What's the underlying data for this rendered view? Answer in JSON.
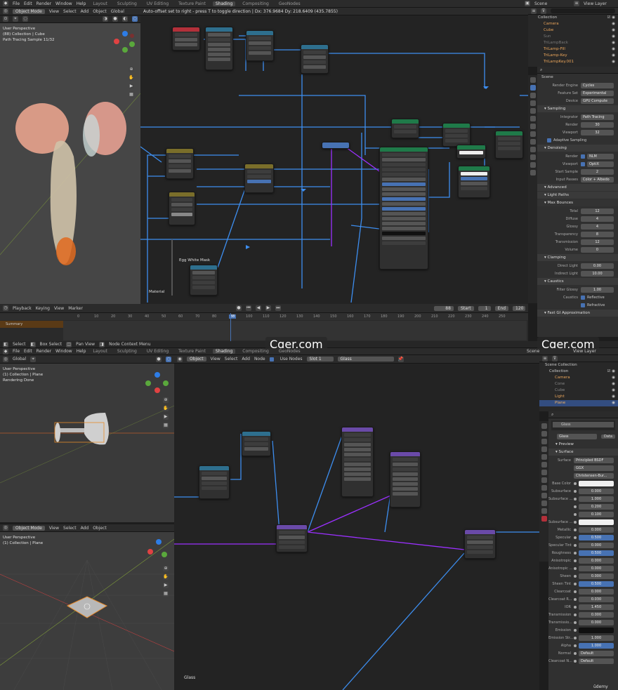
{
  "top": {
    "menu": [
      "File",
      "Edit",
      "Render",
      "Window",
      "Help"
    ],
    "workspaces": [
      "Layout",
      "Sculpting",
      "UV Editing",
      "Texture Paint",
      "Shading",
      "Compositing",
      "GeoNodes"
    ],
    "active_workspace": "Shading",
    "scene": "Scene",
    "view_layer": "View Layer",
    "viewport_header": [
      "Object Mode",
      "View",
      "Select",
      "Add",
      "Object"
    ],
    "transform": "Global",
    "node_status": "Auto-offset set to right - press T to toggle direction  |  Dx: 376.9684   Dy: 218.6409 (435.7855)",
    "viewport_info": [
      "User Perspective",
      "(88) Collection | Cube",
      "Path Tracing Sample 11/32"
    ],
    "node_frame_label": "Egg White Mask",
    "material_label": "Material",
    "outliner_title": "Collection",
    "outliner": [
      {
        "name": "Camera"
      },
      {
        "name": "Cube"
      },
      {
        "name": "Sun"
      },
      {
        "name": "TriLampBack"
      },
      {
        "name": "TriLamp-Fill"
      },
      {
        "name": "TriLamp-Key"
      },
      {
        "name": "TriLampKey.001"
      }
    ],
    "timeline": {
      "menu": [
        "Playback",
        "Keying",
        "View",
        "Marker"
      ],
      "current": "88",
      "start_label": "Start",
      "start": "1",
      "end_label": "End",
      "end": "120",
      "summary": "Summary",
      "ticks": [
        "0",
        "10",
        "20",
        "30",
        "40",
        "50",
        "60",
        "70",
        "80",
        "88",
        "100",
        "110",
        "120",
        "130",
        "140",
        "150",
        "160",
        "170",
        "180",
        "190",
        "200",
        "210",
        "220",
        "230",
        "240",
        "250"
      ]
    },
    "status": [
      "Select",
      "Box Select",
      "Pan View",
      "Node Context Menu"
    ],
    "watermark": "Cger.com",
    "props": {
      "scene": "Scene",
      "render_engine_label": "Render Engine",
      "render_engine": "Cycles",
      "feature_set_label": "Feature Set",
      "feature_set": "Experimental",
      "device_label": "Device",
      "device": "GPU Compute",
      "sampling": "Sampling",
      "integrator_label": "Integrator",
      "integrator": "Path Tracing",
      "render_label": "Render",
      "render_samples": "30",
      "viewport_label": "Viewport",
      "viewport_samples": "32",
      "adaptive": "Adaptive Sampling",
      "denoising": "Denoising",
      "denoise_render": "NLM",
      "denoise_viewport": "OptiX",
      "start_sample_label": "Start Sample",
      "start_sample": "2",
      "input_passes_label": "Input Passes",
      "input_passes": "Color + Albedo",
      "advanced": "Advanced",
      "light_paths": "Light Paths",
      "max_bounces": "Max Bounces",
      "bounces": [
        {
          "label": "Total",
          "value": "12"
        },
        {
          "label": "Diffuse",
          "value": "4"
        },
        {
          "label": "Glossy",
          "value": "4"
        },
        {
          "label": "Transparency",
          "value": "8"
        },
        {
          "label": "Transmission",
          "value": "12"
        },
        {
          "label": "Volume",
          "value": "0"
        }
      ],
      "clamping": "Clamping",
      "direct_label": "Direct Light",
      "direct": "0.00",
      "indirect_label": "Indirect Light",
      "indirect": "10.00",
      "caustics": "Caustics",
      "filter_glossy_label": "Filter Glossy",
      "filter_glossy": "1.00",
      "caustics_label": "Caustics",
      "reflective": "Reflective",
      "refractive": "Refractive",
      "fast_gi": "Fast GI Approximation"
    }
  },
  "bottom": {
    "status": [
      "Select",
      "Box Select",
      "Pan View",
      "Node Context Menu"
    ],
    "scene": "Scene",
    "view_layer": "View Layer",
    "watermark": "Cger.com",
    "viewport_header": [
      "Global"
    ],
    "node_header": [
      "Object",
      "View",
      "Select",
      "Add",
      "Node"
    ],
    "use_nodes": "Use Nodes",
    "slot": "Slot 1",
    "material": "Glass",
    "viewport_info_top": [
      "User Perspective",
      "(1) Collection | Plane",
      "Rendering Done"
    ],
    "viewport_info_bottom": [
      "User Perspective",
      "(1) Collection | Plane"
    ],
    "viewport2_header": [
      "Object Mode",
      "View",
      "Select",
      "Add",
      "Object"
    ],
    "node_label": "Glass",
    "outliner_root": "Scene Collection",
    "outliner_title": "Collection",
    "outliner": [
      {
        "name": "Camera"
      },
      {
        "name": "Cone"
      },
      {
        "name": "Cube"
      },
      {
        "name": "Light"
      },
      {
        "name": "Plane"
      }
    ],
    "mat_list": "Glass",
    "mat_field": "Glass",
    "mat_data": "Data",
    "preview": "Preview",
    "surface": "Surface",
    "surface_label": "Surface",
    "surface_shader": "Principled BSDF",
    "distribution": "GGX",
    "subsurface_method": "Christensen-Bur...",
    "rows": [
      {
        "label": "Base Color",
        "value": "",
        "kind": "white"
      },
      {
        "label": "Subsurface",
        "value": "0.000",
        "kind": "num"
      },
      {
        "label": "Subsurface ...",
        "value": "1.000",
        "kind": "num"
      },
      {
        "label": "",
        "value": "0.200",
        "kind": "num"
      },
      {
        "label": "",
        "value": "0.100",
        "kind": "num"
      },
      {
        "label": "Subsurface ...",
        "value": "",
        "kind": "white"
      },
      {
        "label": "Metallic",
        "value": "0.000",
        "kind": "num"
      },
      {
        "label": "Specular",
        "value": "0.500",
        "kind": "fill"
      },
      {
        "label": "Specular Tint",
        "value": "0.000",
        "kind": "num"
      },
      {
        "label": "Roughness",
        "value": "0.500",
        "kind": "fill"
      },
      {
        "label": "Anisotropic",
        "value": "0.000",
        "kind": "num"
      },
      {
        "label": "Anisotropic ...",
        "value": "0.000",
        "kind": "num"
      },
      {
        "label": "Sheen",
        "value": "0.000",
        "kind": "num"
      },
      {
        "label": "Sheen Tint",
        "value": "0.500",
        "kind": "fill"
      },
      {
        "label": "Clearcoat",
        "value": "0.000",
        "kind": "num"
      },
      {
        "label": "Clearcoat R...",
        "value": "0.030",
        "kind": "num"
      },
      {
        "label": "IOR",
        "value": "1.450",
        "kind": "num"
      },
      {
        "label": "Transmission",
        "value": "0.000",
        "kind": "num"
      },
      {
        "label": "Transmissio...",
        "value": "0.000",
        "kind": "num"
      },
      {
        "label": "Emission",
        "value": "",
        "kind": "black"
      },
      {
        "label": "Emission Str...",
        "value": "1.000",
        "kind": "num"
      },
      {
        "label": "Alpha",
        "value": "1.000",
        "kind": "fill"
      },
      {
        "label": "Normal",
        "value": "Default",
        "kind": "text"
      },
      {
        "label": "Clearcoat N...",
        "value": "Default",
        "kind": "text"
      }
    ],
    "udemy": "ūdemy"
  },
  "colors": {
    "accent": "#4772b3",
    "wire_blue": "#3d8ef0",
    "wire_purple": "#9b30ff",
    "header_green": "#1f7a49",
    "header_purple": "#6a4aa8",
    "header_red": "#b3303a",
    "header_teal": "#2e6f8e",
    "header_olive": "#7a6e2a"
  }
}
